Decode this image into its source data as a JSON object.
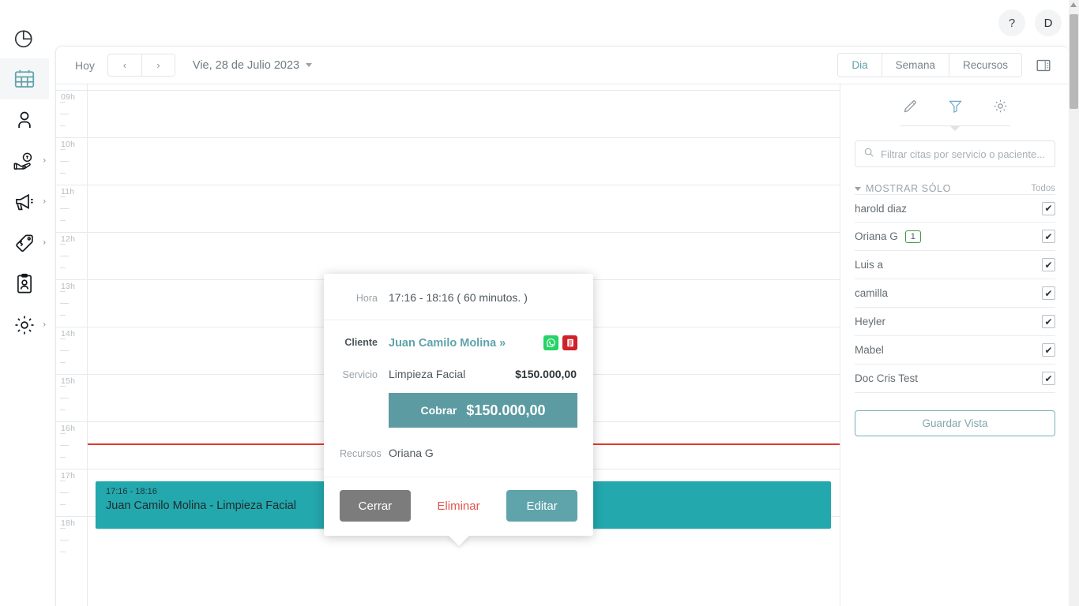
{
  "header": {
    "help_label": "?",
    "avatar_label": "D"
  },
  "toolbar": {
    "today_label": "Hoy",
    "prev_label": "‹",
    "next_label": "›",
    "date_label": "Vie, 28 de Julio 2023",
    "views": [
      {
        "label": "Dia",
        "selected": true
      },
      {
        "label": "Semana",
        "selected": false
      },
      {
        "label": "Recursos",
        "selected": false
      }
    ],
    "panel_toggle_icon": "panel-toggle-icon"
  },
  "sidebar": {
    "items": [
      {
        "icon": "chart-pie-icon",
        "name": "reports",
        "active": false,
        "chevron": false
      },
      {
        "icon": "calendar-icon",
        "name": "calendar",
        "active": true,
        "chevron": false
      },
      {
        "icon": "user-icon",
        "name": "patients",
        "active": false,
        "chevron": false
      },
      {
        "icon": "hand-money-icon",
        "name": "billing",
        "active": false,
        "chevron": true
      },
      {
        "icon": "megaphone-icon",
        "name": "marketing",
        "active": false,
        "chevron": true
      },
      {
        "icon": "price-tag-icon",
        "name": "products",
        "active": false,
        "chevron": true
      },
      {
        "icon": "id-card-icon",
        "name": "staff",
        "active": false,
        "chevron": false
      },
      {
        "icon": "gear-icon",
        "name": "settings",
        "active": false,
        "chevron": true
      }
    ]
  },
  "calendar": {
    "hours": [
      "09h",
      "10h",
      "11h",
      "12h",
      "13h",
      "14h",
      "15h",
      "16h",
      "17h",
      "18h"
    ],
    "now_line_color": "#e03a30",
    "appointment": {
      "time": "17:16 - 18:16",
      "title": "Juan Camilo Molina - Limpieza Facial",
      "color": "#23a8ad"
    }
  },
  "panel": {
    "icons": [
      {
        "name": "pencil-icon",
        "selected": false
      },
      {
        "name": "filter-icon",
        "selected": true
      },
      {
        "name": "gear-icon",
        "selected": false
      }
    ],
    "search_placeholder": "Filtrar citas por servicio o paciente...",
    "show_only_label": "MOSTRAR SÓLO",
    "all_label": "Todos",
    "resources": [
      {
        "name": "harold diaz",
        "badge": "",
        "checked": true
      },
      {
        "name": "Oriana G",
        "badge": "1",
        "checked": true
      },
      {
        "name": "Luis a",
        "badge": "",
        "checked": true
      },
      {
        "name": "camilla",
        "badge": "",
        "checked": true
      },
      {
        "name": "Heyler",
        "badge": "",
        "checked": true
      },
      {
        "name": "Mabel",
        "badge": "",
        "checked": true
      },
      {
        "name": "Doc Cris Test",
        "badge": "",
        "checked": true
      }
    ],
    "save_view_label": "Guardar Vista"
  },
  "popover": {
    "hora_label": "Hora",
    "hora_value": "17:16 - 18:16 ( 60 minutos. )",
    "cliente_label": "Cliente",
    "cliente_value": "Juan Camilo Molina »",
    "whatsapp_icon": "whatsapp-icon",
    "records_icon": "medical-record-icon",
    "servicio_label": "Servicio",
    "servicio_name": "Limpieza Facial",
    "servicio_price": "$150.000,00",
    "cobrar_label": "Cobrar",
    "cobrar_amount": "$150.000,00",
    "cobrar_color": "#5d9ba2",
    "recursos_label": "Recursos",
    "recursos_value": "Oriana G",
    "close_label": "Cerrar",
    "delete_label": "Eliminar",
    "edit_label": "Editar"
  }
}
